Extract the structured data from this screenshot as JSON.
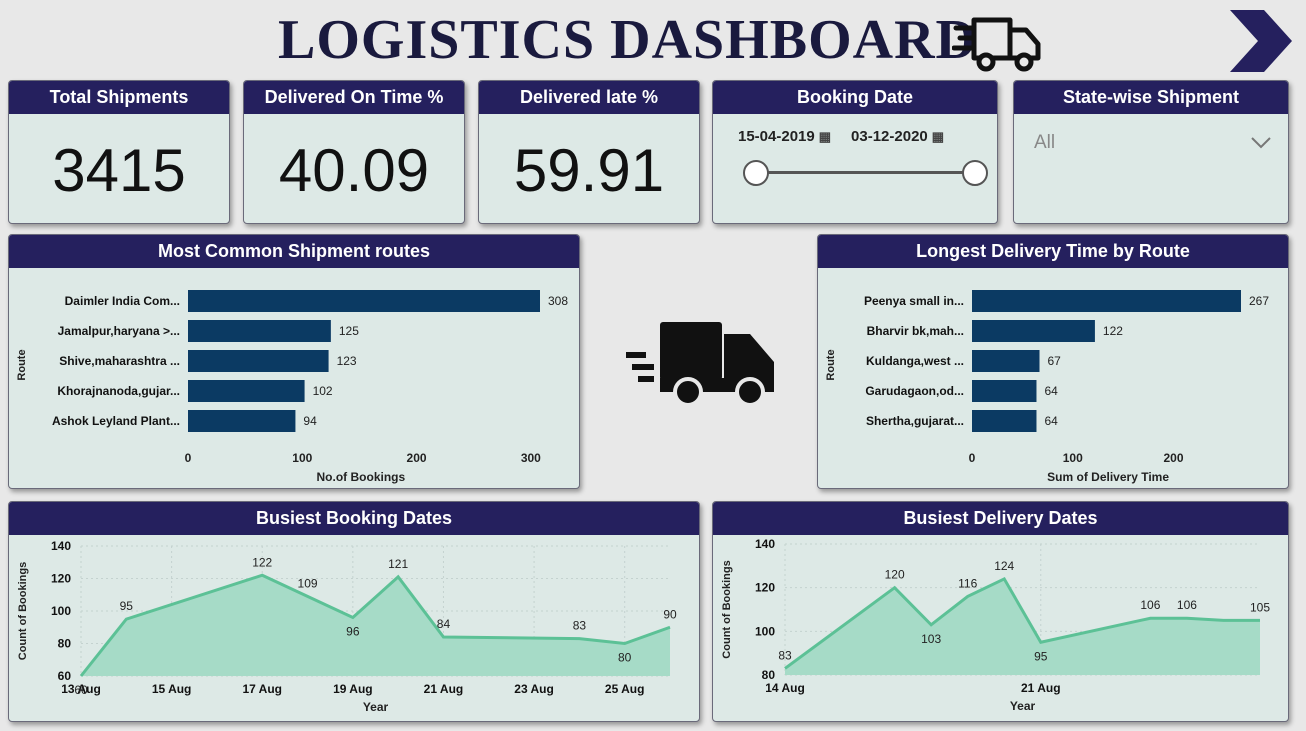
{
  "header": {
    "title": "LOGISTICS DASHBOARD",
    "truck_icon": "delivery-truck-icon",
    "nav_icon": "chevron-right-icon",
    "colors": {
      "title": "#1a1a3e",
      "card_header": "#25205e",
      "card_bg": "#dde9e6",
      "bar": "#0b3a63",
      "area_line": "#5cc196",
      "area_fill": "#a6dbc7"
    }
  },
  "kpis": [
    {
      "label": "Total Shipments",
      "value": "3415"
    },
    {
      "label": "Delivered On Time %",
      "value": "40.09"
    },
    {
      "label": "Delivered late %",
      "value": "59.91"
    }
  ],
  "booking_date": {
    "label": "Booking Date",
    "start": "15-04-2019",
    "end": "03-12-2020",
    "calendar_icon": "calendar-icon"
  },
  "state_filter": {
    "label": "State-wise Shipment",
    "selected": "All"
  },
  "truck_center_icon": "fast-truck-icon",
  "chart_data": [
    {
      "type": "bar",
      "title": "Most Common Shipment routes",
      "categories": [
        "Daimler India Com...",
        "Jamalpur,haryana >...",
        "Shive,maharashtra ...",
        "Khorajnanoda,gujar...",
        "Ashok Leyland Plant..."
      ],
      "values": [
        308,
        125,
        123,
        102,
        94
      ],
      "xlabel": "No.of Bookings",
      "ylabel": "Route",
      "xticks": [
        "0",
        "100",
        "200",
        "300"
      ],
      "xlim": [
        0,
        320
      ]
    },
    {
      "type": "bar",
      "title": "Longest Delivery Time by Route",
      "categories": [
        "Peenya small in...",
        "Bharvir bk,mah...",
        "Kuldanga,west ...",
        "Garudagaon,od...",
        "Shertha,gujarat..."
      ],
      "values": [
        267,
        122,
        67,
        64,
        64
      ],
      "xlabel": "Sum of Delivery Time",
      "ylabel": "Route",
      "xticks": [
        "0",
        "100",
        "200"
      ],
      "xlim": [
        0,
        290
      ]
    },
    {
      "type": "area",
      "title": "Busiest Booking Dates",
      "x": [
        "13 Aug",
        "14 Aug",
        "17 Aug",
        "18 Aug",
        "19 Aug",
        "20 Aug",
        "21 Aug",
        "24 Aug",
        "25 Aug",
        "26 Aug"
      ],
      "x_day": [
        13,
        14,
        17,
        18,
        19,
        20,
        21,
        24,
        25,
        26
      ],
      "values": [
        60,
        95,
        122,
        109,
        96,
        121,
        84,
        83,
        80,
        90
      ],
      "xticks": [
        "13 Aug",
        "15 Aug",
        "17 Aug",
        "19 Aug",
        "21 Aug",
        "23 Aug",
        "25 Aug"
      ],
      "xtick_days": [
        13,
        15,
        17,
        19,
        21,
        23,
        25
      ],
      "xlabel": "Year",
      "ylabel": "Count of Bookings",
      "ylim": [
        60,
        140
      ],
      "yticks": [
        "60",
        "80",
        "100",
        "120",
        "140"
      ]
    },
    {
      "type": "area",
      "title": "Busiest Delivery Dates",
      "x": [
        "14 Aug",
        "17 Aug",
        "18 Aug",
        "19 Aug",
        "20 Aug",
        "21 Aug",
        "24 Aug",
        "25 Aug",
        "26 Aug",
        "27 Aug"
      ],
      "x_day": [
        14,
        17,
        18,
        19,
        20,
        21,
        24,
        25,
        26,
        27
      ],
      "values": [
        83,
        120,
        103,
        116,
        124,
        95,
        106,
        106,
        105,
        105
      ],
      "labels": [
        "83",
        "120",
        "103",
        "116",
        "124",
        "95",
        "106",
        "106",
        "",
        "105"
      ],
      "xticks": [
        "14 Aug",
        "21 Aug"
      ],
      "xtick_days": [
        14,
        21
      ],
      "xlabel": "Year",
      "ylabel": "Count of Bookings",
      "ylim": [
        80,
        140
      ],
      "yticks": [
        "80",
        "100",
        "120",
        "140"
      ]
    }
  ]
}
